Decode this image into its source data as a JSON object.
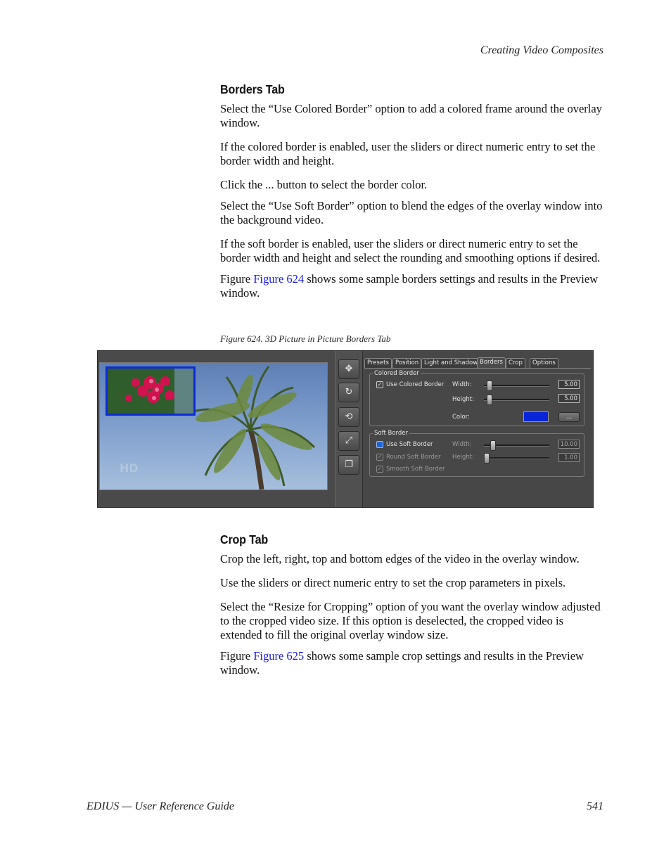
{
  "running_head": "Creating Video Composites",
  "borders_section": {
    "heading": "Borders Tab",
    "p1": "Select the “Use Colored Border” option to add a colored frame around the overlay window.",
    "p2": "If the colored border is enabled, user the sliders or direct numeric entry to set the border width and height.",
    "p3": "Click the ... button to select the border color.",
    "p4": "Select the “Use Soft Border” option to blend the edges of the overlay window into the background video.",
    "p5": "If the soft border is enabled, user the sliders or direct numeric entry to set the border width and height and select the rounding and smoothing options if desired.",
    "p6_pre": "Figure ",
    "p6_link": "Figure 624",
    "p6_post": " shows some sample borders settings and results in the Preview window."
  },
  "figure": {
    "caption": "Figure 624.  3D Picture in Picture Borders Tab",
    "tool_icons": [
      "move-icon",
      "rotate-icon",
      "spin-icon",
      "scale-icon",
      "layer-icon"
    ],
    "tabs": [
      "Presets",
      "Position",
      "Light and Shadow",
      "Borders",
      "Crop",
      "Options"
    ],
    "active_tab": "Borders",
    "colored_border": {
      "title": "Colored Border",
      "use_label": "Use Colored Border",
      "use_checked": true,
      "width_label": "Width:",
      "width_value": "5.00",
      "height_label": "Height:",
      "height_value": "5.00",
      "color_label": "Color:",
      "color": "#0a24d8",
      "color_button": "..."
    },
    "soft_border": {
      "title": "Soft Border",
      "use_label": "Use Soft Border",
      "use_checked": false,
      "round_label": "Round Soft Border",
      "smooth_label": "Smooth Soft Border",
      "width_label": "Width:",
      "width_value": "10.00",
      "height_label": "Height:",
      "height_value": "1.00"
    }
  },
  "crop_section": {
    "heading": "Crop Tab",
    "p1": "Crop the left, right, top and bottom edges of the video in the overlay window.",
    "p2": "Use the sliders or direct numeric entry to set the crop parameters in pixels.",
    "p3": "Select the “Resize for Cropping” option of you want the overlay window adjusted to the cropped video size. If this option is deselected, the cropped video is extended to fill the original overlay window size.",
    "p4_pre": "Figure ",
    "p4_link": "Figure 625",
    "p4_post": " shows some sample crop settings and results in the Preview window."
  },
  "footer": {
    "left": "EDIUS  —  User Reference Guide",
    "page_number": "541"
  }
}
